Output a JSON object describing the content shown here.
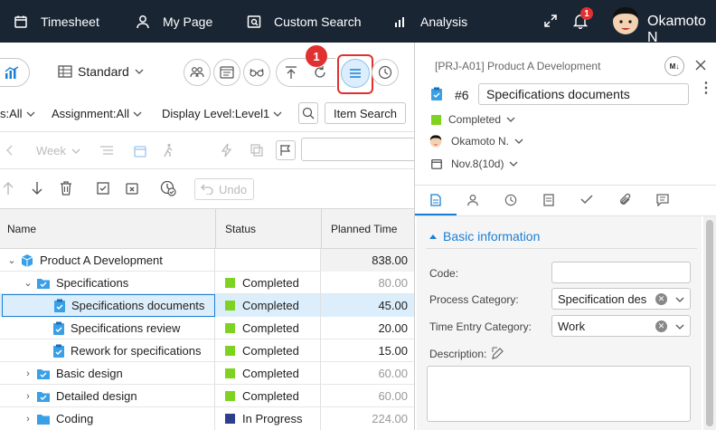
{
  "nav": {
    "timesheet": "Timesheet",
    "mypage": "My Page",
    "custom_search": "Custom Search",
    "analysis": "Analysis",
    "badge": "1",
    "user": "Okamoto N"
  },
  "toolbar": {
    "view": "Standard",
    "callout": "1"
  },
  "filters": {
    "status": "s:All",
    "assignment": "Assignment:All",
    "display_level": "Display Level:Level1",
    "item_search": "Item Search"
  },
  "toolbar3": {
    "period": "Week"
  },
  "toolbar4": {
    "undo": "Undo"
  },
  "grid": {
    "headers": {
      "name": "Name",
      "status": "Status",
      "planned": "Planned Time"
    },
    "rows": [
      {
        "name": "Product A Development",
        "status": "",
        "planned": "838.00"
      },
      {
        "name": "Specifications",
        "status": "Completed",
        "planned": "80.00"
      },
      {
        "name": "Specifications documents",
        "status": "Completed",
        "planned": "45.00"
      },
      {
        "name": "Specifications review",
        "status": "Completed",
        "planned": "20.00"
      },
      {
        "name": "Rework for specifications",
        "status": "Completed",
        "planned": "15.00"
      },
      {
        "name": "Basic design",
        "status": "Completed",
        "planned": "60.00"
      },
      {
        "name": "Detailed design",
        "status": "Completed",
        "planned": "60.00"
      },
      {
        "name": "Coding",
        "status": "In Progress",
        "planned": "224.00"
      }
    ]
  },
  "panel": {
    "project": "[PRJ-A01] Product A Development",
    "md": "M↓",
    "item_no": "#6",
    "title": "Specifications documents",
    "status": "Completed",
    "assignee": "Okamoto N.",
    "date": "Nov.8(10d)",
    "section": "Basic information",
    "labels": {
      "code": "Code:",
      "process": "Process Category:",
      "time_entry": "Time Entry Category:",
      "description": "Description:"
    },
    "values": {
      "code": "",
      "process": "Specification des",
      "time_entry": "Work"
    }
  },
  "colors": {
    "completed": "#7ed321",
    "in_progress": "#2c3e8c",
    "accent": "#1a7fd4",
    "callout": "#e03030",
    "nav_bg": "#1a2533"
  }
}
